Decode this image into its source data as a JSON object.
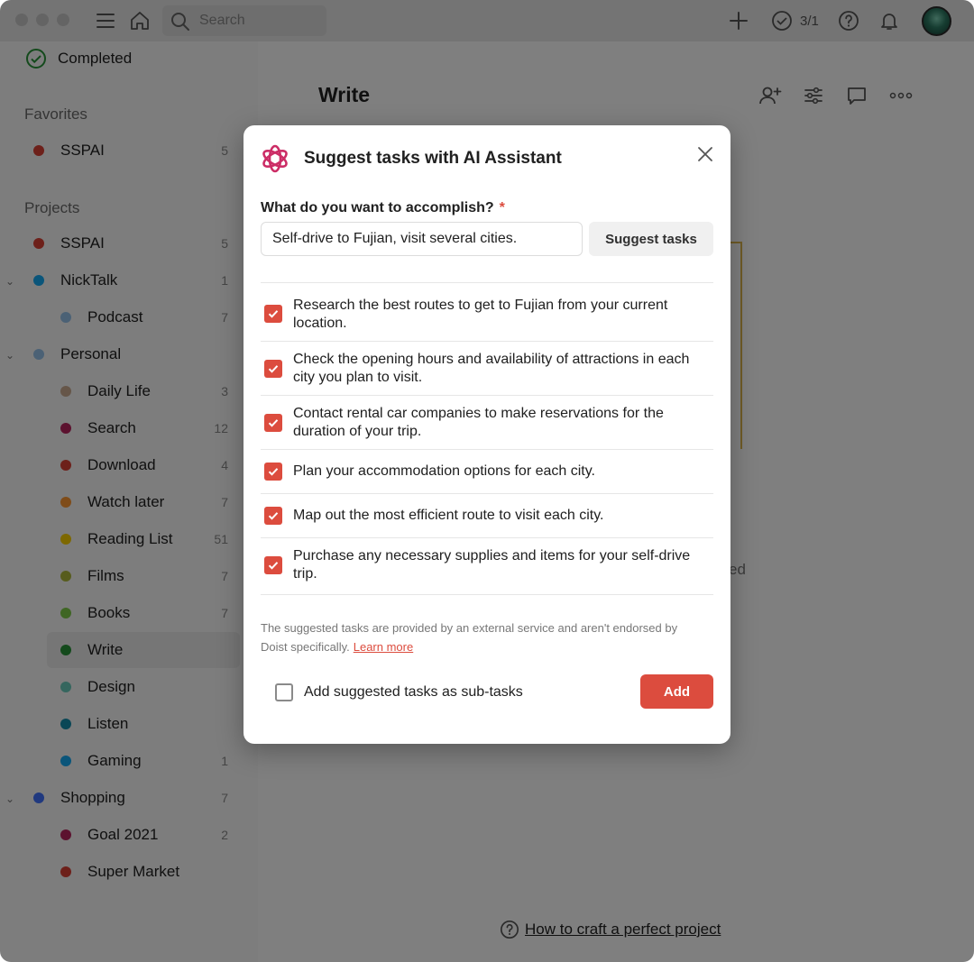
{
  "topbar": {
    "search_placeholder": "Search",
    "task_count": "3/1",
    "icons": [
      "menu-icon",
      "home-icon",
      "search-icon",
      "plus-icon",
      "check-circle-icon",
      "help-icon",
      "bell-icon"
    ]
  },
  "sidebar": {
    "completed_label": "Completed",
    "favorites_label": "Favorites",
    "projects_label": "Projects",
    "favorites": [
      {
        "name": "SSPAI",
        "count": "5",
        "color": "#db4035"
      }
    ],
    "projects": [
      {
        "name": "SSPAI",
        "count": "5",
        "color": "#db4035"
      },
      {
        "name": "NickTalk",
        "count": "1",
        "color": "#14aaf5"
      },
      {
        "name": "Podcast",
        "count": "7",
        "color": "#96c3eb"
      },
      {
        "name": "Personal",
        "count": "",
        "color": "#96c3eb"
      },
      {
        "name": "Daily Life",
        "count": "3",
        "color": "#ccac93"
      },
      {
        "name": "Search",
        "count": "12",
        "color": "#b8255f"
      },
      {
        "name": "Download",
        "count": "4",
        "color": "#db4035"
      },
      {
        "name": "Watch later",
        "count": "7",
        "color": "#ff9933"
      },
      {
        "name": "Reading List",
        "count": "51",
        "color": "#fad000"
      },
      {
        "name": "Films",
        "count": "7",
        "color": "#afb83b"
      },
      {
        "name": "Books",
        "count": "7",
        "color": "#7ecc49"
      },
      {
        "name": "Write",
        "count": "",
        "color": "#299438"
      },
      {
        "name": "Design",
        "count": "",
        "color": "#6accbc"
      },
      {
        "name": "Listen",
        "count": "",
        "color": "#158fad"
      },
      {
        "name": "Gaming",
        "count": "1",
        "color": "#14aaf5"
      },
      {
        "name": "Shopping",
        "count": "7",
        "color": "#4073ff"
      },
      {
        "name": "Goal 2021",
        "count": "2",
        "color": "#b8255f"
      },
      {
        "name": "Super Market",
        "count": "",
        "color": "#db4035"
      }
    ]
  },
  "main": {
    "title": "Write",
    "background_text": "ed",
    "help_link": "How to craft a perfect project",
    "icons": [
      "add-person-icon",
      "filter-icon",
      "comment-icon",
      "more-icon"
    ]
  },
  "modal": {
    "title": "Suggest tasks with AI Assistant",
    "question": "What do you want to accomplish?",
    "required_mark": "*",
    "input_value": "Self-drive to Fujian, visit several cities.",
    "suggest_button": "Suggest tasks",
    "tasks": [
      {
        "text": "Research the best routes to get to Fujian from your current location.",
        "checked": true
      },
      {
        "text": "Check the opening hours and availability of attractions in each city you plan to visit.",
        "checked": true
      },
      {
        "text": "Contact rental car companies to make reservations for the duration of your trip.",
        "checked": true
      },
      {
        "text": "Plan your accommodation options for each city.",
        "checked": true
      },
      {
        "text": "Map out the most efficient route to visit each city.",
        "checked": true
      },
      {
        "text": "Purchase any necessary supplies and items for your self-drive trip.",
        "checked": true
      }
    ],
    "disclaimer": "The suggested tasks are provided by an external service and aren't endorsed by Doist specifically.",
    "learn_more": "Learn more",
    "subtasks_label": "Add suggested tasks as sub-tasks",
    "add_button": "Add",
    "accent_color": "#dc4c3e"
  }
}
